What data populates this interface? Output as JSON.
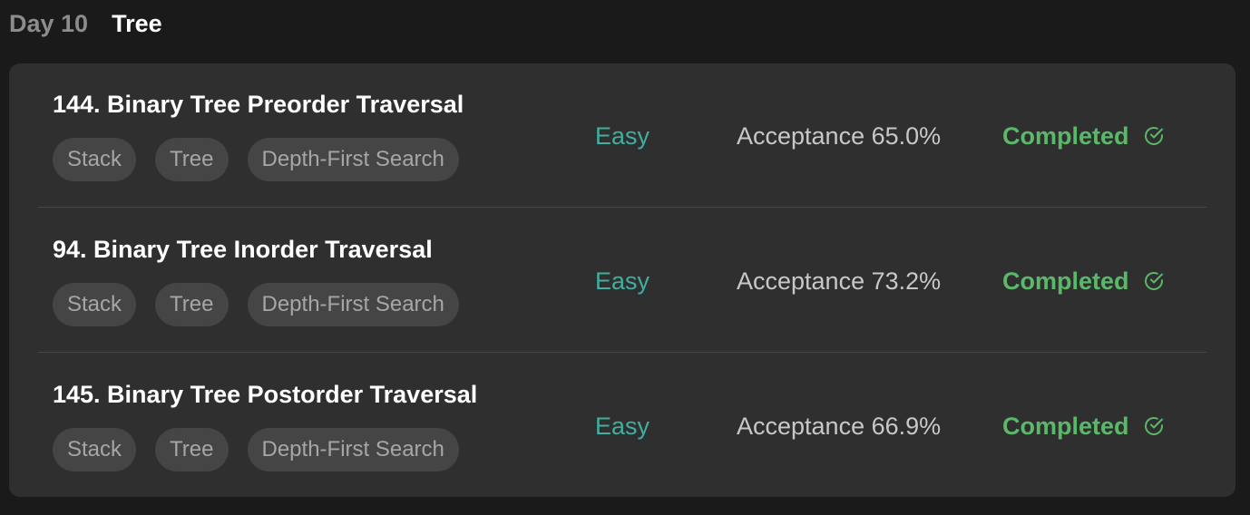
{
  "header": {
    "day": "Day 10",
    "topic": "Tree"
  },
  "problems": [
    {
      "title": "144. Binary Tree Preorder Traversal",
      "tags": [
        "Stack",
        "Tree",
        "Depth-First Search"
      ],
      "difficulty": "Easy",
      "acceptance": "Acceptance 65.0%",
      "status": "Completed"
    },
    {
      "title": "94. Binary Tree Inorder Traversal",
      "tags": [
        "Stack",
        "Tree",
        "Depth-First Search"
      ],
      "difficulty": "Easy",
      "acceptance": "Acceptance 73.2%",
      "status": "Completed"
    },
    {
      "title": "145. Binary Tree Postorder Traversal",
      "tags": [
        "Stack",
        "Tree",
        "Depth-First Search"
      ],
      "difficulty": "Easy",
      "acceptance": "Acceptance 66.9%",
      "status": "Completed"
    }
  ],
  "icons": {
    "status": "check-circle-icon"
  },
  "colors": {
    "easy": "#3fb0a0",
    "completed": "#5ab968"
  }
}
